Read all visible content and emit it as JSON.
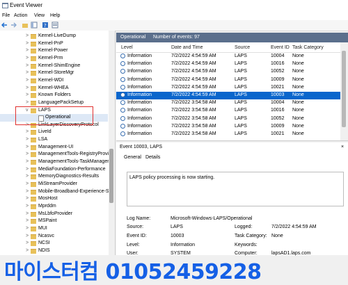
{
  "window": {
    "title": "Event Viewer"
  },
  "menu": [
    "File",
    "Action",
    "View",
    "Help"
  ],
  "tree": {
    "items": [
      {
        "label": "Kernel-LiveDump",
        "chev": ">"
      },
      {
        "label": "Kernel-PnP",
        "chev": ">"
      },
      {
        "label": "Kernel-Power",
        "chev": ">"
      },
      {
        "label": "Kernel-Prm",
        "chev": ">"
      },
      {
        "label": "Kernel-ShimEngine",
        "chev": ">"
      },
      {
        "label": "Kernel-StoreMgr",
        "chev": ">"
      },
      {
        "label": "Kernel-WDI",
        "chev": ">"
      },
      {
        "label": "Kernel-WHEA",
        "chev": ">"
      },
      {
        "label": "Known Folders",
        "chev": ">"
      },
      {
        "label": "LanguagePackSetup",
        "chev": ">"
      },
      {
        "label": "LAPS",
        "chev": "v"
      },
      {
        "label": "Operational",
        "chev": ""
      },
      {
        "label": "LinkLayerDiscoveryProtocol",
        "chev": ">"
      },
      {
        "label": "LiveId",
        "chev": ">"
      },
      {
        "label": "LSA",
        "chev": ">"
      },
      {
        "label": "Management-UI",
        "chev": ">"
      },
      {
        "label": "ManagementTools-RegistryProvi",
        "chev": ">"
      },
      {
        "label": "ManagementTools-TaskManager",
        "chev": ">"
      },
      {
        "label": "MediaFoundation-Performance",
        "chev": ">"
      },
      {
        "label": "MemoryDiagnostics-Results",
        "chev": ">"
      },
      {
        "label": "MiStreamProvider",
        "chev": ">"
      },
      {
        "label": "Mobile-Broadband-Experience-S",
        "chev": ">"
      },
      {
        "label": "MosHost",
        "chev": ">"
      },
      {
        "label": "Mprddm",
        "chev": ">"
      },
      {
        "label": "MsLbfoProvider",
        "chev": ">"
      },
      {
        "label": "MSPaint",
        "chev": ">"
      },
      {
        "label": "MUI",
        "chev": ">"
      },
      {
        "label": "Ncasvc",
        "chev": ">"
      },
      {
        "label": "NCSI",
        "chev": ">"
      },
      {
        "label": "NDIS",
        "chev": ">"
      }
    ]
  },
  "pane": {
    "name": "Operational",
    "count_label": "Number of events: 97"
  },
  "grid": {
    "headers": [
      "Level",
      "Date and Time",
      "Source",
      "Event ID",
      "Task Category"
    ],
    "rows": [
      [
        "Information",
        "7/2/2022 4:54:59 AM",
        "LAPS",
        "10004",
        "None"
      ],
      [
        "Information",
        "7/2/2022 4:54:59 AM",
        "LAPS",
        "10016",
        "None"
      ],
      [
        "Information",
        "7/2/2022 4:54:59 AM",
        "LAPS",
        "10052",
        "None"
      ],
      [
        "Information",
        "7/2/2022 4:54:59 AM",
        "LAPS",
        "10009",
        "None"
      ],
      [
        "Information",
        "7/2/2022 4:54:59 AM",
        "LAPS",
        "10021",
        "None"
      ],
      [
        "Information",
        "7/2/2022 4:54:59 AM",
        "LAPS",
        "10003",
        "None"
      ],
      [
        "Information",
        "7/2/2022 3:54:58 AM",
        "LAPS",
        "10004",
        "None"
      ],
      [
        "Information",
        "7/2/2022 3:54:58 AM",
        "LAPS",
        "10016",
        "None"
      ],
      [
        "Information",
        "7/2/2022 3:54:58 AM",
        "LAPS",
        "10052",
        "None"
      ],
      [
        "Information",
        "7/2/2022 3:54:58 AM",
        "LAPS",
        "10009",
        "None"
      ],
      [
        "Information",
        "7/2/2022 3:54:58 AM",
        "LAPS",
        "10021",
        "None"
      ]
    ],
    "selected_index": 5
  },
  "detail": {
    "title": "Event 10003, LAPS",
    "close": "×",
    "tabs": [
      "General",
      "Details"
    ],
    "description": "LAPS policy processing is now starting.",
    "props": {
      "log_name_label": "Log Name:",
      "log_name": "Microsoft-Windows-LAPS/Operational",
      "source_label": "Source:",
      "source": "LAPS",
      "logged_label": "Logged:",
      "logged": "7/2/2022 4:54:59 AM",
      "event_id_label": "Event ID:",
      "event_id": "10003",
      "task_label": "Task Category:",
      "task": "None",
      "level_label": "Level:",
      "level": "Information",
      "keywords_label": "Keywords:",
      "user_label": "User:",
      "user": "SYSTEM",
      "computer_label": "Computer:",
      "computer": "lapsAD1.laps.com"
    }
  },
  "watermark": {
    "text": "마이스터컴 01052459228"
  },
  "colors": {
    "header_bar": "#5b6f8c",
    "selection": "#0a66cc",
    "highlight_box": "#e0302e",
    "watermark": "#1560e6"
  }
}
